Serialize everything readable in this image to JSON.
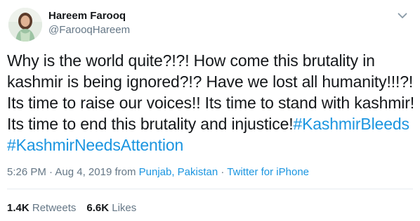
{
  "author": {
    "name": "Hareem Farooq",
    "handle": "@FarooqHareem",
    "avatar_icon": "profile-photo"
  },
  "tweet": {
    "lines": [
      "Why is the world quite?!?! How come this brutality in",
      "kashmir is being ignored?!? Have we lost all humanity!!!?!",
      "Its time to raise our voices!! Its time to stand with kashmir!",
      "Its time to end this brutality and injustice!"
    ],
    "hashtags": [
      "#KashmirBleeds",
      "#KashmirNeedsAttention"
    ]
  },
  "meta": {
    "time": "5:26 PM",
    "sep1": " · ",
    "date": "Aug 4, 2019",
    "from_label": " from ",
    "location": "Punjab, Pakistan",
    "sep2": " · ",
    "source": "Twitter for iPhone"
  },
  "stats": {
    "retweets_count": "1.4K",
    "retweets_label": "Retweets",
    "likes_count": "6.6K",
    "likes_label": "Likes"
  },
  "colors": {
    "link": "#1b95e0",
    "secondary_text": "#657786",
    "primary_text": "#14171a",
    "divider": "#e6ecf0"
  },
  "icons": {
    "menu": "chevron-down-icon"
  }
}
